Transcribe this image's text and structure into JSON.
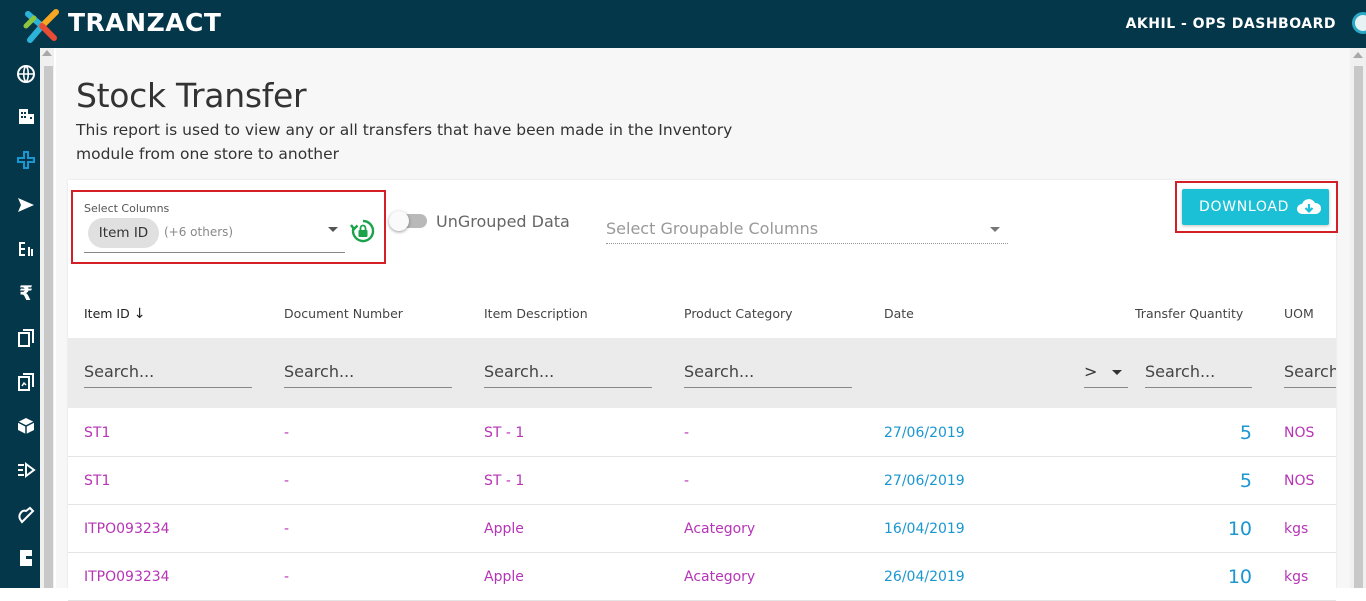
{
  "app": {
    "brand": "TRANZACT",
    "user": "AKHIL - OPS DASHBOARD"
  },
  "sidebar": {
    "icons": [
      "globe-icon",
      "building-icon",
      "plus-icon",
      "send-icon",
      "list-icon",
      "rupee-icon",
      "documents-icon",
      "report-icon",
      "box-icon",
      "fast-forward-icon",
      "handshake-icon",
      "exit-icon"
    ]
  },
  "page": {
    "title": "Stock Transfer",
    "description": "This report is used to view any or all transfers that have been made in the Inventory module from one store to another"
  },
  "filters": {
    "select_columns_label": "Select Columns",
    "select_columns_chip": "Item ID",
    "select_columns_more": "(+6 others)",
    "toggle_label": "UnGrouped Data",
    "group_placeholder": "Select Groupable Columns",
    "download_label": "DOWNLOAD"
  },
  "table": {
    "headers": [
      "Item ID",
      "Document Number",
      "Item Description",
      "Product Category",
      "Date",
      "Transfer Quantity",
      "UOM"
    ],
    "search_placeholder": "Search...",
    "search_uom": "Search.",
    "date_operator": ">",
    "rows": [
      {
        "item_id": "ST1",
        "doc": "-",
        "desc": "ST - 1",
        "cat": "-",
        "date": "27/06/2019",
        "qty": "5",
        "uom": "NOS"
      },
      {
        "item_id": "ST1",
        "doc": "-",
        "desc": "ST - 1",
        "cat": "-",
        "date": "27/06/2019",
        "qty": "5",
        "uom": "NOS"
      },
      {
        "item_id": "ITPO093234",
        "doc": "-",
        "desc": "Apple",
        "cat": "Acategory",
        "date": "16/04/2019",
        "qty": "10",
        "uom": "kgs"
      },
      {
        "item_id": "ITPO093234",
        "doc": "-",
        "desc": "Apple",
        "cat": "Acategory",
        "date": "26/04/2019",
        "qty": "10",
        "uom": "kgs"
      }
    ]
  },
  "colors": {
    "topbar": "#05374a",
    "accent": "#1bc0d7",
    "highlight": "#d32026",
    "link_purple": "#b634b6",
    "link_blue": "#1a96d0"
  }
}
